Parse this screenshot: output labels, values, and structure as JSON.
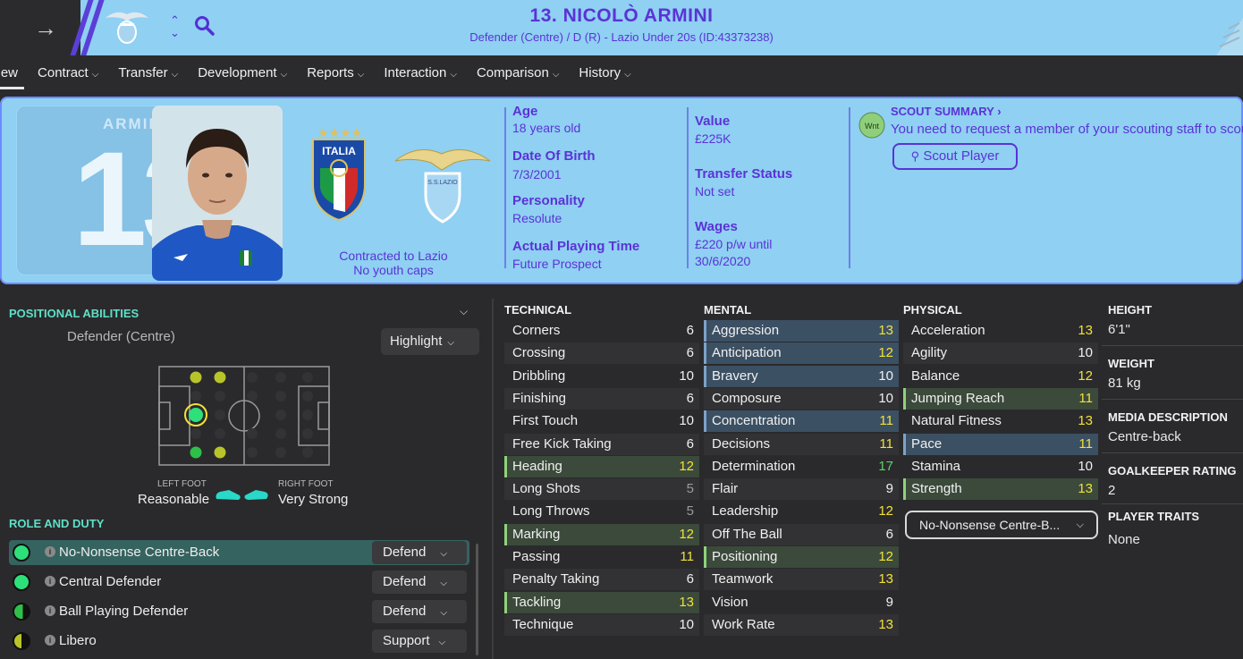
{
  "header": {
    "player_title": "13. NICOLÒ ARMINI",
    "player_subtitle": "Defender (Centre) / D (R) - Lazio Under 20s (ID:43373238)"
  },
  "tabs": [
    {
      "label": "Overview",
      "shown": "view",
      "active": true
    },
    {
      "label": "Contract"
    },
    {
      "label": "Transfer"
    },
    {
      "label": "Development"
    },
    {
      "label": "Reports"
    },
    {
      "label": "Interaction"
    },
    {
      "label": "Comparison"
    },
    {
      "label": "History"
    }
  ],
  "profile": {
    "shirt_name": "ARMIN",
    "shirt_number": "13",
    "contract_line1": "Contracted to Lazio",
    "contract_line2": "No youth caps",
    "italia_text": "ITALIA",
    "club_text": "S.S.LAZIO",
    "age_label": "Age",
    "age_value": "18 years old",
    "dob_label": "Date Of Birth",
    "dob_value": "7/3/2001",
    "personality_label": "Personality",
    "personality_value": "Resolute",
    "apt_label": "Actual Playing Time",
    "apt_value": "Future Prospect",
    "value_label": "Value",
    "value_value": "£225K",
    "transfer_label": "Transfer Status",
    "transfer_value": "Not set",
    "wages_label": "Wages",
    "wages_value1": "£220 p/w until",
    "wages_value2": "30/6/2020",
    "scout_icon_text": "Wnt",
    "scout_title": "SCOUT SUMMARY",
    "scout_text": "You need to request a member of your scouting staff to scout him",
    "scout_button": "Scout Player"
  },
  "left": {
    "positional_title": "POSITIONAL ABILITIES",
    "position": "Defender (Centre)",
    "highlight_label": "Highlight",
    "left_foot_label": "LEFT FOOT",
    "left_foot_value": "Reasonable",
    "right_foot_label": "RIGHT FOOT",
    "right_foot_value": "Very Strong",
    "role_title": "ROLE AND DUTY",
    "roles": [
      {
        "name": "No-Nonsense Centre-Back",
        "duty": "Defend",
        "selected": true
      },
      {
        "name": "Central Defender",
        "duty": "Defend"
      },
      {
        "name": "Ball Playing Defender",
        "duty": "Defend"
      },
      {
        "name": "Libero",
        "duty": "Support"
      }
    ]
  },
  "attributes": {
    "technical_title": "TECHNICAL",
    "mental_title": "MENTAL",
    "physical_title": "PHYSICAL",
    "technical": [
      {
        "name": "Corners",
        "value": "6",
        "color": "w"
      },
      {
        "name": "Crossing",
        "value": "6",
        "color": "w"
      },
      {
        "name": "Dribbling",
        "value": "10",
        "color": "w"
      },
      {
        "name": "Finishing",
        "value": "6",
        "color": "w"
      },
      {
        "name": "First Touch",
        "value": "10",
        "color": "w"
      },
      {
        "name": "Free Kick Taking",
        "value": "6",
        "color": "w"
      },
      {
        "name": "Heading",
        "value": "12",
        "color": "y",
        "hl": "k"
      },
      {
        "name": "Long Shots",
        "value": "5",
        "color": "g"
      },
      {
        "name": "Long Throws",
        "value": "5",
        "color": "g"
      },
      {
        "name": "Marking",
        "value": "12",
        "color": "y",
        "hl": "k"
      },
      {
        "name": "Passing",
        "value": "11",
        "color": "y"
      },
      {
        "name": "Penalty Taking",
        "value": "6",
        "color": "w"
      },
      {
        "name": "Tackling",
        "value": "13",
        "color": "y",
        "hl": "k"
      },
      {
        "name": "Technique",
        "value": "10",
        "color": "w"
      }
    ],
    "mental": [
      {
        "name": "Aggression",
        "value": "13",
        "color": "y",
        "hl": "b"
      },
      {
        "name": "Anticipation",
        "value": "12",
        "color": "y",
        "hl": "b"
      },
      {
        "name": "Bravery",
        "value": "10",
        "color": "w",
        "hl": "b"
      },
      {
        "name": "Composure",
        "value": "10",
        "color": "w"
      },
      {
        "name": "Concentration",
        "value": "11",
        "color": "y",
        "hl": "b"
      },
      {
        "name": "Decisions",
        "value": "11",
        "color": "y"
      },
      {
        "name": "Determination",
        "value": "17",
        "color": "gn"
      },
      {
        "name": "Flair",
        "value": "9",
        "color": "w"
      },
      {
        "name": "Leadership",
        "value": "12",
        "color": "y"
      },
      {
        "name": "Off The Ball",
        "value": "6",
        "color": "w"
      },
      {
        "name": "Positioning",
        "value": "12",
        "color": "y",
        "hl": "k"
      },
      {
        "name": "Teamwork",
        "value": "13",
        "color": "y"
      },
      {
        "name": "Vision",
        "value": "9",
        "color": "w"
      },
      {
        "name": "Work Rate",
        "value": "13",
        "color": "y"
      }
    ],
    "physical": [
      {
        "name": "Acceleration",
        "value": "13",
        "color": "y"
      },
      {
        "name": "Agility",
        "value": "10",
        "color": "w"
      },
      {
        "name": "Balance",
        "value": "12",
        "color": "y"
      },
      {
        "name": "Jumping Reach",
        "value": "11",
        "color": "y",
        "hl": "k"
      },
      {
        "name": "Natural Fitness",
        "value": "13",
        "color": "y"
      },
      {
        "name": "Pace",
        "value": "11",
        "color": "y",
        "hl": "b"
      },
      {
        "name": "Stamina",
        "value": "10",
        "color": "w"
      },
      {
        "name": "Strength",
        "value": "13",
        "color": "y",
        "hl": "k"
      }
    ],
    "role_select": "No-Nonsense Centre-B..."
  },
  "info": {
    "height_label": "HEIGHT",
    "height_value": "6'1\"",
    "weight_label": "WEIGHT",
    "weight_value": "81 kg",
    "media_label": "MEDIA DESCRIPTION",
    "media_value": "Centre-back",
    "gk_label": "GOALKEEPER RATING",
    "gk_value": "2",
    "traits_label": "PLAYER TRAITS",
    "traits_value": "None"
  },
  "colors": {
    "accent": "#5a33d6",
    "header_bg": "#8fd0f3",
    "teal_title": "#5ee0c8",
    "value_yellow": "#f3e13a",
    "value_green": "#5dd46a"
  }
}
